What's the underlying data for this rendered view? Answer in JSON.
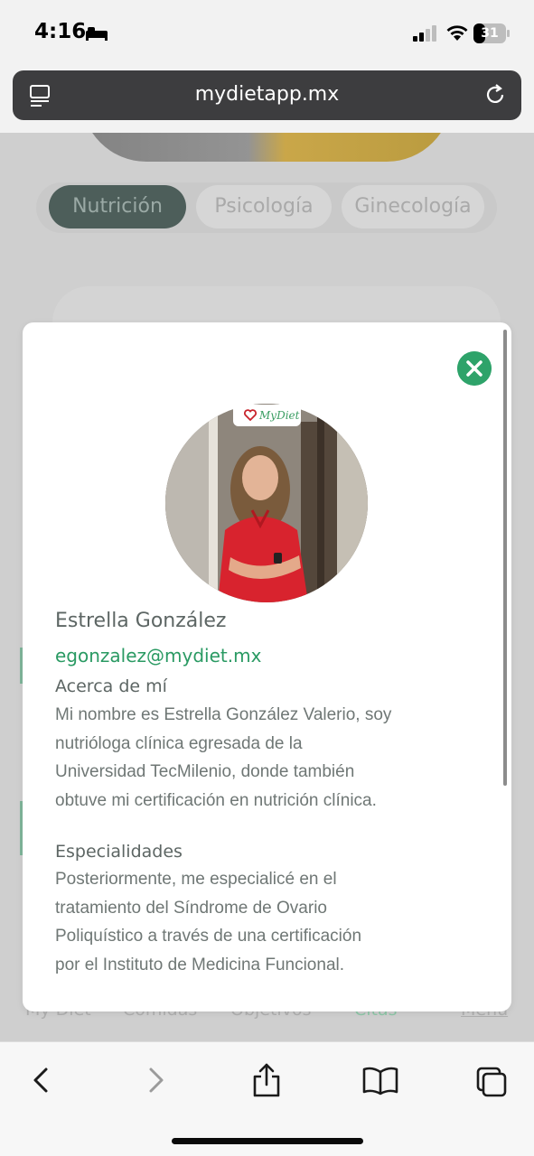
{
  "status_bar": {
    "time": "4:16",
    "battery": "31"
  },
  "browser": {
    "url": "mydietapp.mx"
  },
  "background": {
    "tabs": [
      "Nutrición",
      "Psicología",
      "Ginecología"
    ],
    "bottom_nav": [
      "My Diet",
      "Comidas",
      "Objetivos",
      "Citas",
      "Menú"
    ]
  },
  "modal": {
    "logo": "MyDiet",
    "name": "Estrella González",
    "email": "egonzalez@mydiet.mx",
    "about_title": "Acerca de mí",
    "about_lines": [
      "Mi nombre es Estrella González Valerio, soy",
      "nutrióloga clínica egresada de la",
      "Universidad TecMilenio, donde también",
      "obtuve mi certificación en nutrición clínica."
    ],
    "specialties_title": "Especialidades",
    "specialties_lines": [
      "Posteriormente, me especialicé en el",
      "tratamiento del Síndrome de Ovario",
      "Poliquístico a través de una certificación",
      "por el Instituto de Medicina Funcional."
    ]
  }
}
